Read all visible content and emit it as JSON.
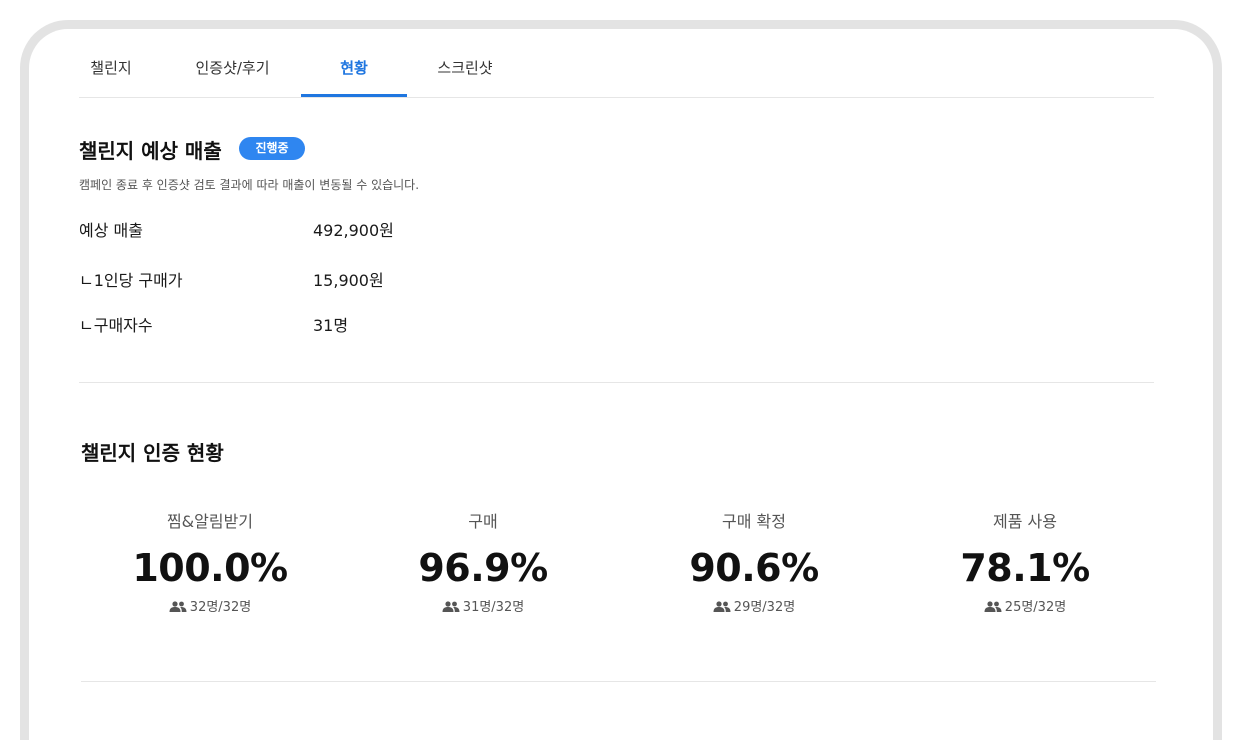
{
  "tabs": [
    {
      "label": "챌린지"
    },
    {
      "label": "인증샷/후기"
    },
    {
      "label": "현황"
    },
    {
      "label": "스크린샷"
    }
  ],
  "active_tab": "현황",
  "accent_color": "#1f76e0",
  "badge_color": "#2f86f0",
  "sales": {
    "title": "챌린지 예상 매출",
    "status_badge": "진행중",
    "note": "캠페인 종료 후 인증샷 검토 결과에 따라 매출이 변동될 수 있습니다.",
    "rows": [
      {
        "label": "예상 매출",
        "value": "492,900원"
      },
      {
        "label": "ㄴ1인당 구매가",
        "value": "15,900원"
      },
      {
        "label": "ㄴ구매자수",
        "value": "31명"
      }
    ]
  },
  "certification": {
    "title": "챌린지 인증 현황",
    "stats": [
      {
        "label": "찜&알림받기",
        "percent": "100.0%",
        "count": "32명/32명",
        "icon": "people-icon"
      },
      {
        "label": "구매",
        "percent": "96.9%",
        "count": "31명/32명",
        "icon": "people-icon"
      },
      {
        "label": "구매 확정",
        "percent": "90.6%",
        "count": "29명/32명",
        "icon": "people-icon"
      },
      {
        "label": "제품 사용",
        "percent": "78.1%",
        "count": "25명/32명",
        "icon": "people-icon"
      }
    ]
  }
}
